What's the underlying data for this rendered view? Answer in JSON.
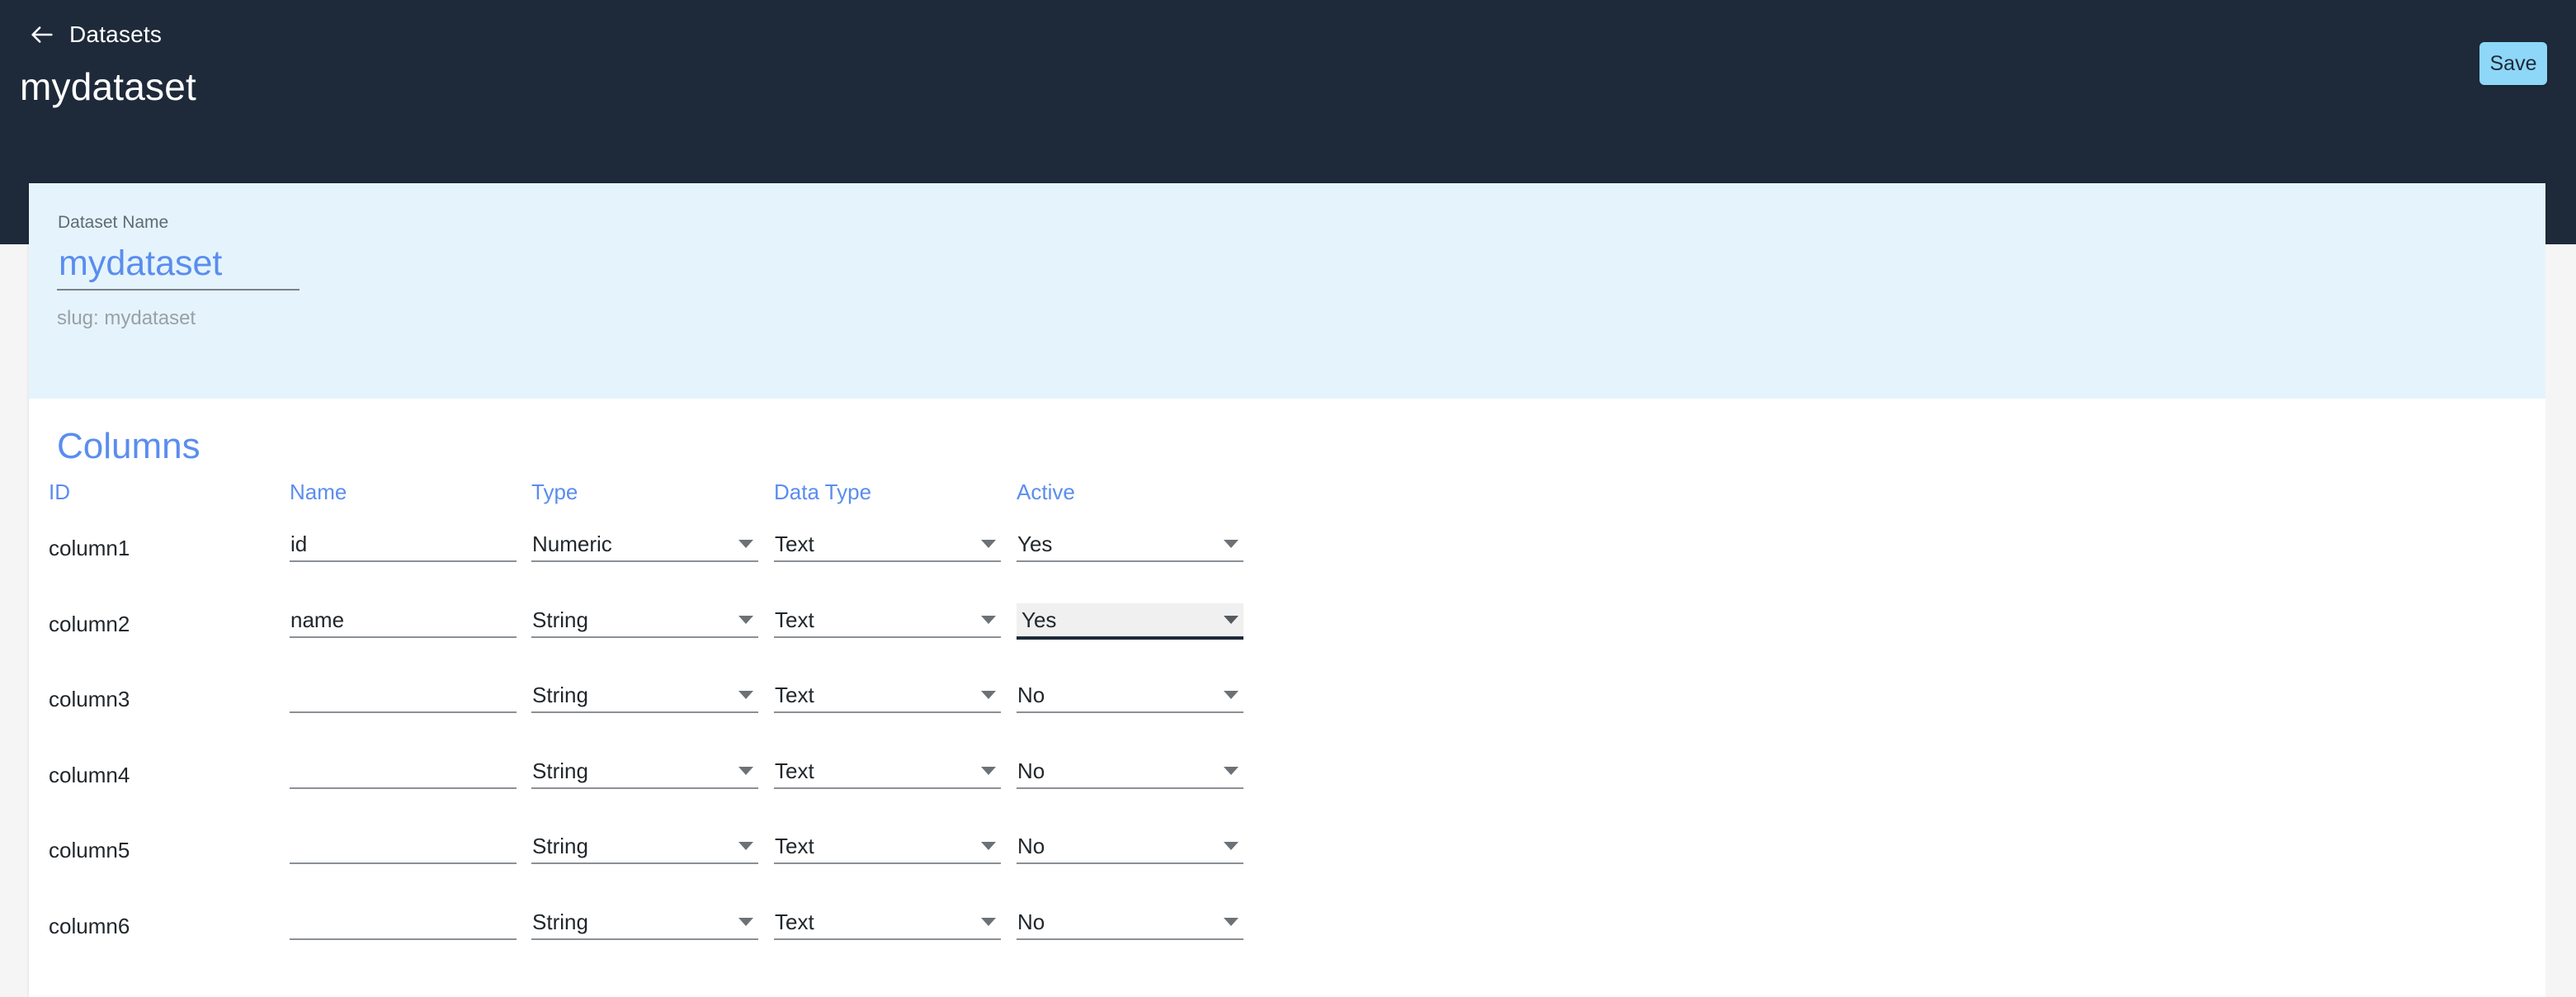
{
  "header": {
    "breadcrumb_label": "Datasets",
    "back_icon": "arrow-left-icon",
    "title": "mydataset",
    "save_label": "Save",
    "background_color": "#1e2a3a",
    "save_color": "#8ed7f8"
  },
  "dataset_section": {
    "field_label": "Dataset Name",
    "name_value": "mydataset",
    "name_placeholder": "Dataset Name",
    "slug_text": "slug: mydataset",
    "background_color": "#e5f4fc",
    "value_color": "#5b8def"
  },
  "columns_section": {
    "heading": "Columns",
    "heading_color": "#5b8def",
    "table": {
      "headers": [
        "ID",
        "Name",
        "Type",
        "Data Type",
        "Active"
      ],
      "rows": [
        {
          "id": "column1",
          "name": "id",
          "type": "Numeric",
          "data_type": "Text",
          "active": "Yes",
          "active_focused": false
        },
        {
          "id": "column2",
          "name": "name",
          "type": "String",
          "data_type": "Text",
          "active": "Yes",
          "active_focused": true
        },
        {
          "id": "column3",
          "name": "",
          "type": "String",
          "data_type": "Text",
          "active": "No",
          "active_focused": false
        },
        {
          "id": "column4",
          "name": "",
          "type": "String",
          "data_type": "Text",
          "active": "No",
          "active_focused": false
        },
        {
          "id": "column5",
          "name": "",
          "type": "String",
          "data_type": "Text",
          "active": "No",
          "active_focused": false
        },
        {
          "id": "column6",
          "name": "",
          "type": "String",
          "data_type": "Text",
          "active": "No",
          "active_focused": false
        }
      ],
      "name_placeholder": "",
      "type_options": [
        "String",
        "Numeric"
      ],
      "data_type_options": [
        "Text"
      ],
      "active_options": [
        "Yes",
        "No"
      ],
      "caret_icon": "chevron-down-icon"
    }
  }
}
